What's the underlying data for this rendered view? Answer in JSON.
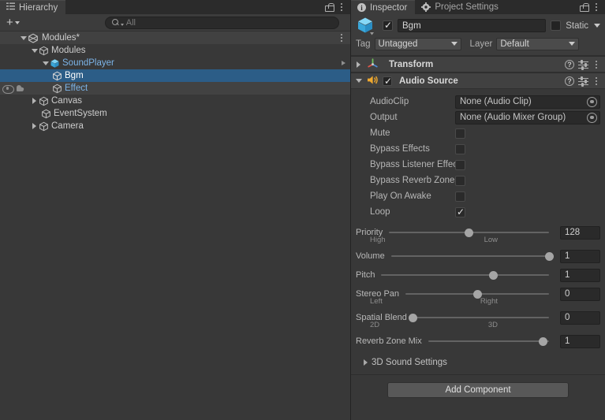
{
  "hierarchy": {
    "tab_label": "Hierarchy",
    "lock_icon": "lock-open-icon",
    "menu_icon": "kebab-menu-icon",
    "toolbar": {
      "add_label": "+",
      "search_placeholder": "All",
      "search_icon": "search-icon"
    },
    "rows": [
      {
        "label": "Modules*",
        "indent": 24,
        "twisty": "open",
        "icon": "scene-icon",
        "state": "header",
        "menu": true
      },
      {
        "label": "Modules",
        "indent": 38,
        "twisty": "open",
        "icon": "gameobject-cube-icon",
        "state": "normal"
      },
      {
        "label": "SoundPlayer",
        "indent": 52,
        "twisty": "open",
        "icon": "prefab-cube-icon",
        "state": "prefab",
        "chevron": true
      },
      {
        "label": "Bgm",
        "indent": 66,
        "twisty": "none",
        "icon": "gameobject-cube-icon",
        "state": "selected"
      },
      {
        "label": "Effect",
        "indent": 66,
        "twisty": "none",
        "icon": "gameobject-cube-icon",
        "state": "prefab-hovered",
        "gutter_icons": [
          "eye-icon",
          "hand-icon"
        ]
      },
      {
        "label": "Canvas",
        "indent": 38,
        "twisty": "closed",
        "icon": "gameobject-cube-icon",
        "state": "normal"
      },
      {
        "label": "EventSystem",
        "indent": 52,
        "twisty": "none",
        "icon": "gameobject-cube-icon",
        "state": "normal"
      },
      {
        "label": "Camera",
        "indent": 38,
        "twisty": "closed",
        "icon": "gameobject-cube-icon",
        "state": "normal"
      }
    ]
  },
  "inspector": {
    "tabs": [
      {
        "label": "Inspector",
        "icon": "info-circle-icon",
        "active": true
      },
      {
        "label": "Project Settings",
        "icon": "gear-icon",
        "active": false
      }
    ],
    "lock_icon": "lock-open-icon",
    "menu_icon": "kebab-menu-icon",
    "gameobject": {
      "icon": "prefab-cube-icon",
      "enabled": true,
      "name": "Bgm",
      "static_label": "Static",
      "static_checked": false,
      "tag_label": "Tag",
      "tag_value": "Untagged",
      "layer_label": "Layer",
      "layer_value": "Default"
    },
    "components": [
      {
        "name": "Transform",
        "icon": "transform-axis-icon",
        "expanded": false,
        "has_enable_toggle": false,
        "help_icon": "help-icon",
        "preset_icon": "preset-sliders-icon",
        "menu_icon": "kebab-menu-icon"
      },
      {
        "name": "Audio Source",
        "icon": "audio-speaker-icon",
        "expanded": true,
        "has_enable_toggle": true,
        "enabled": true,
        "help_icon": "help-icon",
        "preset_icon": "preset-sliders-icon",
        "menu_icon": "kebab-menu-icon"
      }
    ],
    "audio_source": {
      "object_fields": [
        {
          "label": "AudioClip",
          "value": "None (Audio Clip)",
          "picker_icon": "circle-select-icon"
        },
        {
          "label": "Output",
          "value": "None (Audio Mixer Group)",
          "picker_icon": "circle-select-icon"
        }
      ],
      "toggles": [
        {
          "label": "Mute",
          "checked": false
        },
        {
          "label": "Bypass Listener Effec",
          "checked": false
        },
        {
          "label": "Bypass Reverb Zones",
          "checked": false
        },
        {
          "label": "Play On Awake",
          "checked": false
        },
        {
          "label": "Loop",
          "checked": true
        }
      ],
      "bypass_effects": {
        "label": "Bypass Effects",
        "checked": false
      },
      "sliders": [
        {
          "label": "Priority",
          "value": "128",
          "fill": 0.5,
          "left_label": "High",
          "right_label": "Low"
        },
        {
          "label": "Volume",
          "value": "1",
          "fill": 1.0,
          "left_label": "",
          "right_label": ""
        },
        {
          "label": "Pitch",
          "value": "1",
          "fill": 0.655,
          "left_label": "",
          "right_label": ""
        },
        {
          "label": "Stereo Pan",
          "value": "0",
          "fill": 0.5,
          "left_label": "Left",
          "right_label": "Right"
        },
        {
          "label": "Spatial Blend",
          "value": "0",
          "fill": 0.0,
          "left_label": "2D",
          "right_label": "3D"
        },
        {
          "label": "Reverb Zone Mix",
          "value": "1",
          "fill": 0.91,
          "left_label": "",
          "right_label": ""
        }
      ],
      "foldout": {
        "label": "3D Sound Settings",
        "expanded": false
      }
    },
    "add_component_label": "Add Component"
  },
  "colors": {
    "panel_bg": "#383838",
    "header_bg": "#414141",
    "tab_bg": "#2b2b2b",
    "selection_blue": "#2c5d87",
    "prefab_blue": "#7cb4e8",
    "field_bg": "#2a2a2a"
  }
}
